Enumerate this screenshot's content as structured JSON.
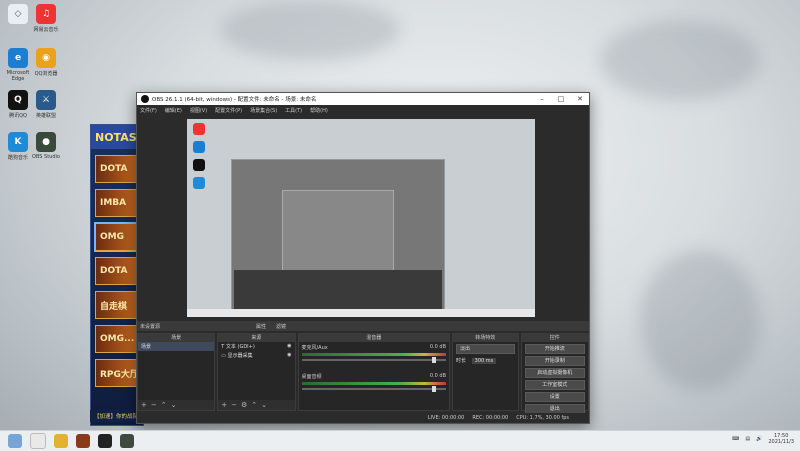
{
  "desktop": {
    "icons": [
      {
        "label": "",
        "color": "#e33"
      },
      {
        "label": "网易云音乐",
        "color": "#d33"
      },
      {
        "label": "Microsoft Edge",
        "color": "#1b7ed3"
      },
      {
        "label": "QQ浏览器",
        "color": "#e9a21b"
      },
      {
        "label": "腾讯QQ",
        "color": "#111"
      },
      {
        "label": "英雄联盟",
        "color": "#2a5a8a"
      },
      {
        "label": "酷狗音乐",
        "color": "#1f8ad6"
      },
      {
        "label": "OBS Studio",
        "color": "#222"
      }
    ]
  },
  "launcher": {
    "header": "NOTAS",
    "games": [
      "DOTA",
      "IMBA",
      "OMG",
      "DOTA",
      "自走棋",
      "OMG...",
      "RPG大厅"
    ],
    "status": "【加速】你的战队中心-赛季战斗开放中"
  },
  "obs": {
    "title": "OBS 26.1.1 (64-bit, windows) - 配置文件: 未命名 - 场景: 未命名",
    "menu": [
      "文件(F)",
      "编辑(E)",
      "视图(V)",
      "配置文件(P)",
      "场景集合(S)",
      "工具(T)",
      "帮助(H)"
    ],
    "scene_label": "未设置源",
    "tabs_hint": [
      "属性",
      "滤镜"
    ],
    "panels": {
      "scenes": {
        "title": "场景",
        "items": [
          "场景"
        ]
      },
      "sources": {
        "title": "来源",
        "items": [
          "文本 (GDI+)",
          "显示器采集"
        ]
      },
      "mixer": {
        "title": "混音器",
        "rows": [
          {
            "name": "麦克风/Aux",
            "level": "0.0 dB"
          },
          {
            "name": "桌面音频",
            "level": "0.0 dB"
          }
        ]
      },
      "transitions": {
        "title": "转场特效",
        "mode": "淡出",
        "duration_label": "时长",
        "duration": "300 ms"
      },
      "controls": {
        "title": "控件",
        "buttons": [
          "开始推流",
          "开始录制",
          "启动虚拟摄像机",
          "工作室模式",
          "设置",
          "退出"
        ]
      }
    },
    "status": {
      "live": "LIVE: 00:00:00",
      "rec": "REC: 00:00:00",
      "cpu": "CPU: 1.7%, 30.00 fps"
    }
  },
  "taskbar": {
    "time": "17:50",
    "date": "2021/11/3"
  }
}
